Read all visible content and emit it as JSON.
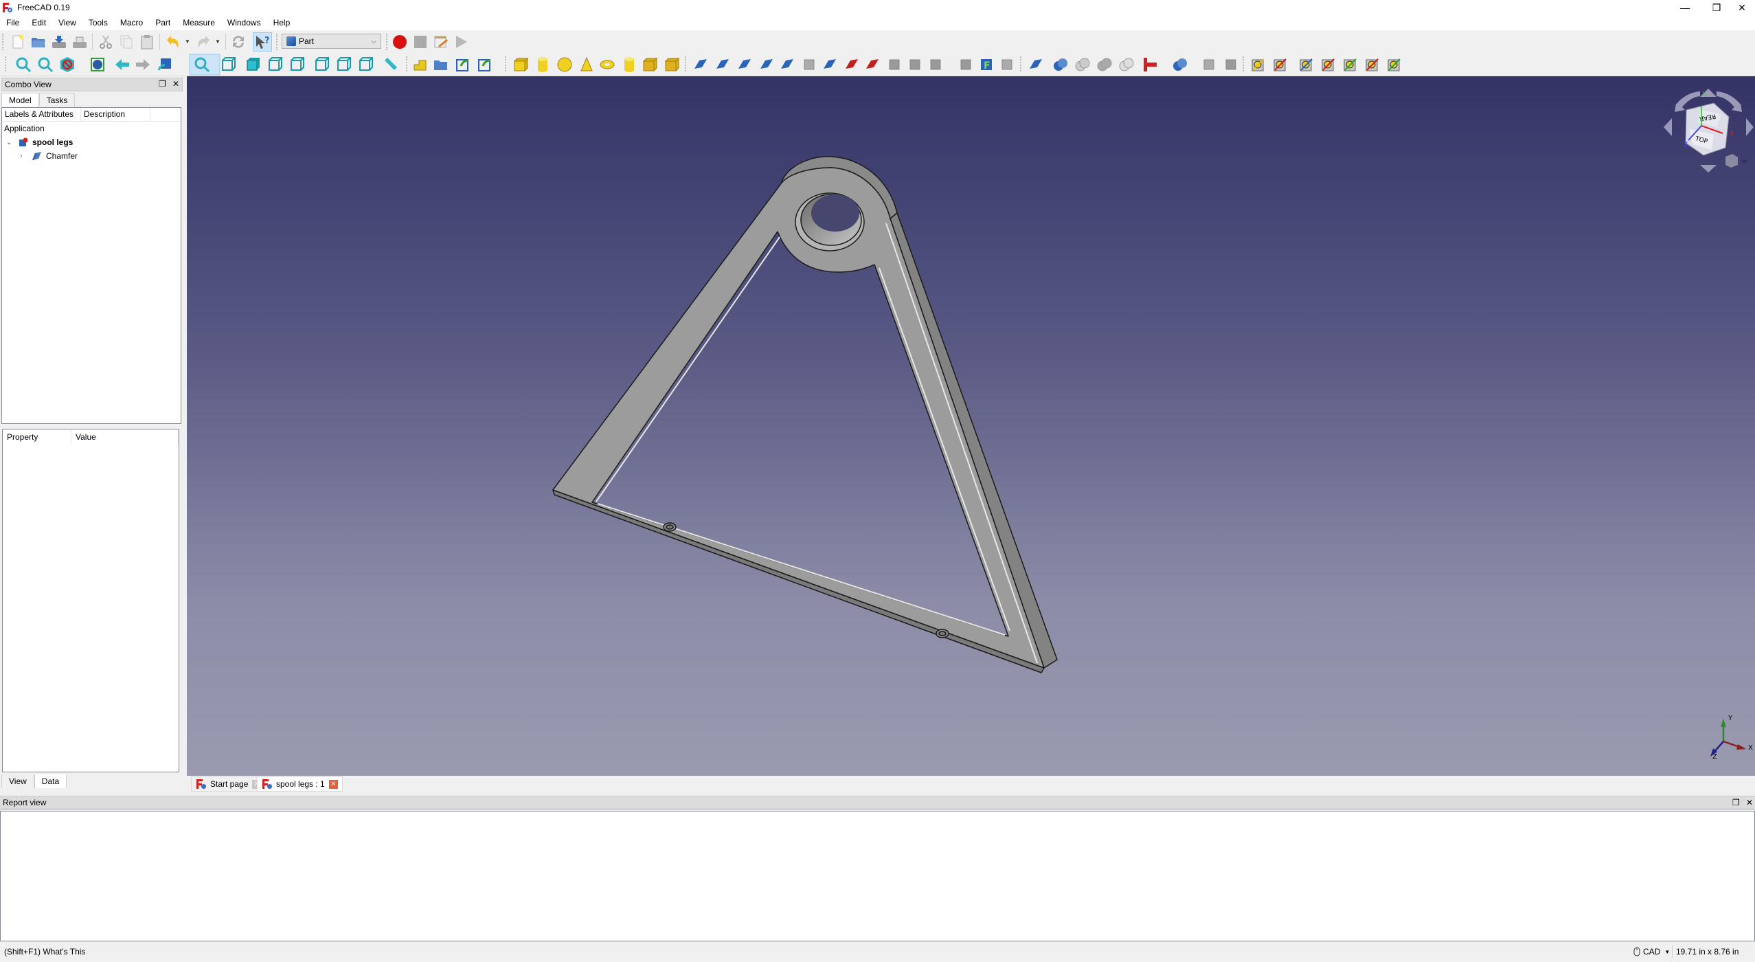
{
  "window": {
    "title": "FreeCAD 0.19",
    "controls": {
      "minimize": "—",
      "restore": "❐",
      "close": "✕"
    }
  },
  "menubar": [
    "File",
    "Edit",
    "View",
    "Tools",
    "Macro",
    "Part",
    "Measure",
    "Windows",
    "Help"
  ],
  "toolbar": {
    "workbench_selector": "Part",
    "file_icons": [
      "new-document-icon",
      "open-icon",
      "save-icon",
      "save-as-icon"
    ],
    "edit_icons": [
      "cut-icon",
      "copy-icon",
      "paste-icon",
      "undo-icon",
      "redo-icon",
      "refresh-icon",
      "whats-this-icon"
    ],
    "macro_icons": [
      "record-macro-icon",
      "stop-macro-icon",
      "edit-macro-icon",
      "run-macro-icon"
    ]
  },
  "combo_view": {
    "title": "Combo View",
    "tabs": [
      "Model",
      "Tasks"
    ],
    "selected_tab": "Model",
    "tree_columns": [
      "Labels & Attributes",
      "Description"
    ],
    "tree_root": "Application",
    "tree_items": [
      {
        "label": "spool legs",
        "bold": true,
        "expanded": true,
        "icon": "document-icon"
      },
      {
        "label": "Chamfer",
        "bold": false,
        "expanded": false,
        "icon": "chamfer-icon"
      }
    ],
    "property_columns": [
      "Property",
      "Value"
    ],
    "bottom_tabs": [
      "View",
      "Data"
    ],
    "bottom_selected": "Data"
  },
  "document_tabs": [
    {
      "label": "Start page",
      "active": false
    },
    {
      "label": "spool legs : 1",
      "active": true
    }
  ],
  "navigation_cube": {
    "faces": [
      "TOP",
      "REAR"
    ],
    "axes": [
      "X",
      "Y",
      "Z"
    ]
  },
  "axis_indicator": [
    "X",
    "Y",
    "Z"
  ],
  "report_view": {
    "title": "Report view",
    "content": ""
  },
  "statusbar": {
    "hint": "(Shift+F1) What's This",
    "nav_style": "CAD",
    "dimensions": "19.71 in x 8.76 in"
  },
  "colors": {
    "viewport_top": "#333366",
    "viewport_bottom": "#9a9ab0",
    "model_face": "#9c9c9c",
    "accent_red": "#e02020"
  }
}
